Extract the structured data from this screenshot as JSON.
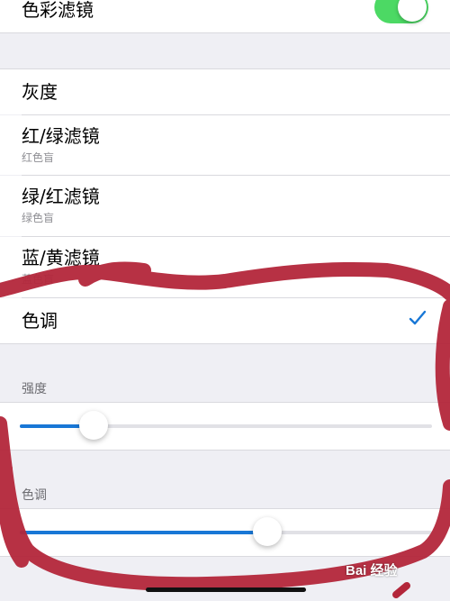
{
  "color_filters": {
    "label": "色彩滤镜",
    "enabled": true
  },
  "filters": [
    {
      "label": "灰度",
      "subtitle": ""
    },
    {
      "label": "红/绿滤镜",
      "subtitle": "红色盲"
    },
    {
      "label": "绿/红滤镜",
      "subtitle": "绿色盲"
    },
    {
      "label": "蓝/黄滤镜",
      "subtitle": "蓝色盲"
    },
    {
      "label": "色调",
      "subtitle": "",
      "selected": true
    }
  ],
  "intensity": {
    "label": "强度",
    "value_percent": 18
  },
  "hue": {
    "label": "色调",
    "value_percent": 60
  },
  "watermark": "Bai 经验",
  "colors": {
    "toggle_on": "#4cd964",
    "accent": "#1877d6",
    "annotation": "#b3263a"
  },
  "icons": {
    "selected": "checkmark-icon"
  }
}
